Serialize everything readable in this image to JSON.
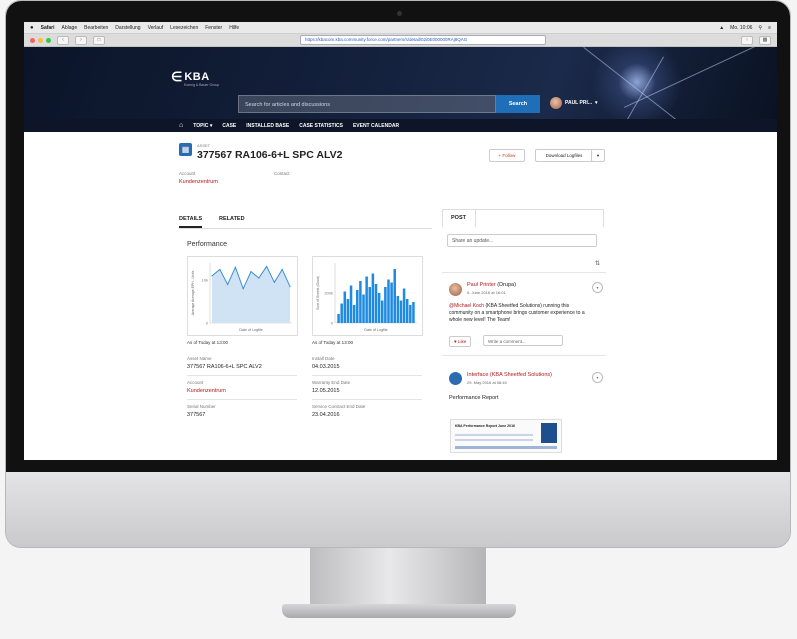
{
  "menubar": {
    "items": [
      "Safari",
      "Ablage",
      "Bearbeiten",
      "Darstellung",
      "Verlauf",
      "Lesezeichen",
      "Fenster",
      "Hilfe"
    ],
    "status": [
      "Mo. 10:06"
    ]
  },
  "browser": {
    "url": "https://kbacom.kba.community.force.com/partners/s/detail/02i0E000000RAj8QAG"
  },
  "site": {
    "logo_text": "KBA",
    "logo_tagline": "Koenig & Bauer Group",
    "search_placeholder": "Search for articles and discussions",
    "search_button": "Search",
    "user_name": "PAUL PRI..."
  },
  "nav": {
    "items": [
      "TOPIC",
      "CASE",
      "INSTALLED BASE",
      "CASE STATISTICS",
      "EVENT CALENDAR"
    ]
  },
  "asset": {
    "type_label": "ASSET",
    "title": "377567 RA106-6+L SPC ALV2",
    "follow_label": "+ Follow",
    "download_label": "Download Logfiles",
    "account_label": "Account",
    "account_value": "Kundenzentrum",
    "contact_label": "Contact"
  },
  "tabs": {
    "details": "DETAILS",
    "related": "RELATED"
  },
  "performance": {
    "title": "Performance",
    "as_of_left": "As of Today at 13:00",
    "as_of_right": "As of Today at 13:00",
    "fields": [
      {
        "label": "Asset Name",
        "value": "377567 RA106-6+L SPC ALV2",
        "link": false
      },
      {
        "label": "Install Date",
        "value": "04.03.2015",
        "link": false
      },
      {
        "label": "Account",
        "value": "Kundenzentrum",
        "link": true
      },
      {
        "label": "Warranty End Date",
        "value": "12.05.2015",
        "link": false
      },
      {
        "label": "Serial Number",
        "value": "377567",
        "link": false
      },
      {
        "label": "Service Contract End Date",
        "value": "23.04.2016",
        "link": false
      }
    ]
  },
  "chart_data": [
    {
      "type": "area",
      "title": "",
      "xlabel": "Date of Logfile",
      "ylabel": "Average Average EPH - Units",
      "ytick_labels": [
        "10k",
        "0"
      ],
      "ylim": [
        0,
        14000
      ],
      "values": [
        11000,
        12500,
        9000,
        13000,
        8000,
        12000,
        10500,
        13200,
        9500,
        12500,
        8500
      ]
    },
    {
      "type": "bar",
      "title": "",
      "xlabel": "Date of Logfile",
      "ylabel": "Sum of Sheets (Good)",
      "ytick_labels": [
        "200k",
        "0"
      ],
      "ylim": [
        0,
        400000
      ],
      "values": [
        60000,
        130000,
        210000,
        160000,
        250000,
        120000,
        220000,
        280000,
        190000,
        310000,
        240000,
        330000,
        260000,
        200000,
        150000,
        240000,
        290000,
        270000,
        360000,
        180000,
        150000,
        230000,
        160000,
        120000,
        140000
      ]
    }
  ],
  "feed": {
    "post_tab": "POST",
    "share_placeholder": "Share an update...",
    "post1": {
      "author": "Paul Printer",
      "author_suffix": " (Drupa)",
      "date": "5. June 2016 at 16:01",
      "mention": "@Michael Koch",
      "body": " (KBA Sheetfed Solutions) running this community on a smartphone brings customer experience to a whole new level! The Team!",
      "like": "Like",
      "comment_placeholder": "Write a comment..."
    },
    "post2": {
      "author": "Interface (KBA Sheetfed Solutions)",
      "date": "29. May 2016 at 08:40",
      "title": "Performance Report",
      "thumb_title": "KBA Performance Report June 2016"
    }
  }
}
